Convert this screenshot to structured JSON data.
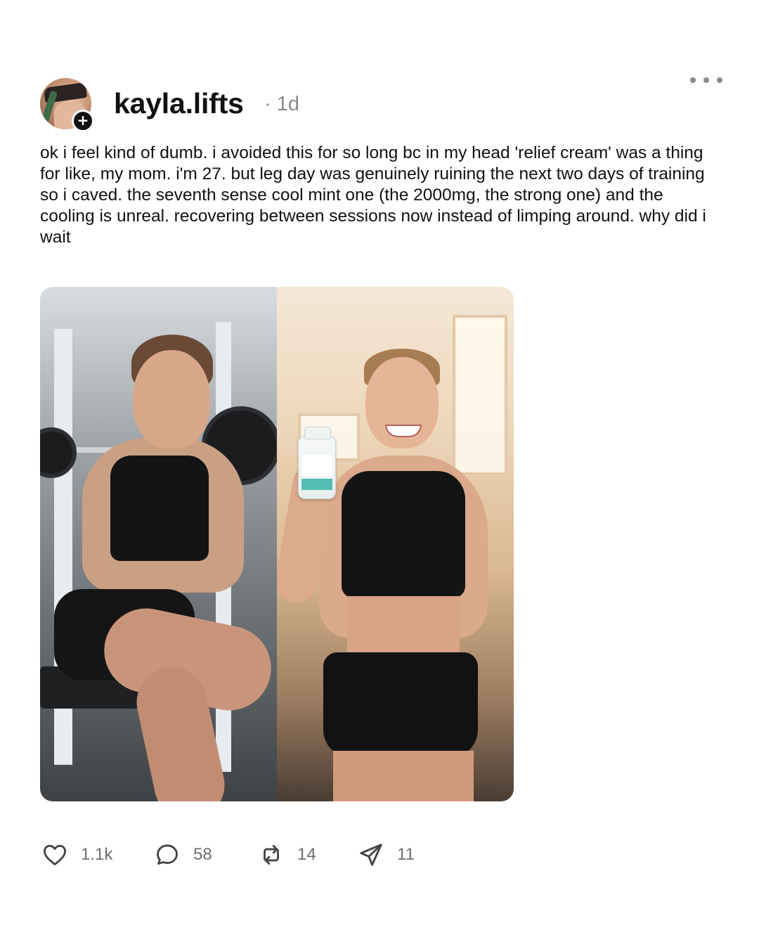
{
  "post": {
    "username": "kayla.lifts",
    "timestamp": "· 1d",
    "follow_badge": "+",
    "body": "ok i feel kind of dumb. i avoided this for so long bc in my head 'relief cream' was a thing for like, my mom. i'm 27. but leg day was genuinely ruining the next two days of training so i caved. the seventh sense cool mint one (the 2000mg, the strong one) and the cooling is unreal. recovering between sessions now instead of limping around. why did i wait",
    "media": {
      "left_image": "gym-pain-photo",
      "right_image": "gym-smiling-with-cream-photo"
    },
    "actions": {
      "like_count": "1.1k",
      "reply_count": "58",
      "repost_count": "14",
      "share_count": "11"
    },
    "icons": {
      "like": "heart-icon",
      "reply": "speech-bubble-icon",
      "repost": "repost-arrows-icon",
      "share": "send-icon",
      "more": "more-horizontal-icon"
    },
    "colors": {
      "text": "#111111",
      "muted": "#8a8a8a",
      "count": "#6e6e6e",
      "background": "#ffffff"
    }
  }
}
